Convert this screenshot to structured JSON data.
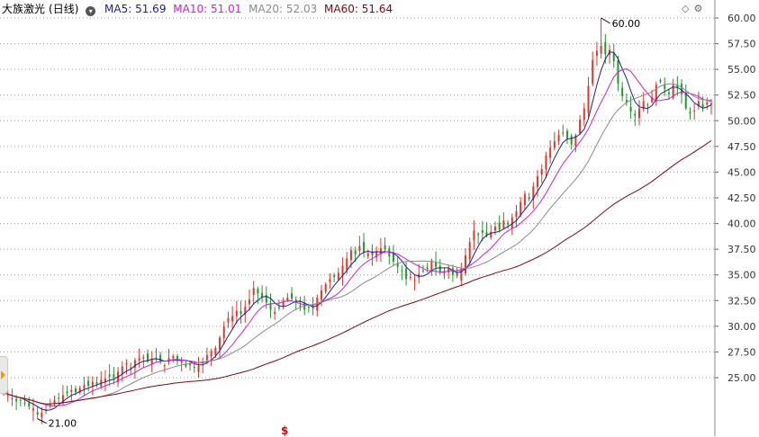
{
  "legend": {
    "symbol": "大族激光",
    "period": "(日线)",
    "items": [
      {
        "label": "MA5: 51.69",
        "color": "#1f1f8f"
      },
      {
        "label": "MA10: 51.01",
        "color": "#d020d0"
      },
      {
        "label": "MA20: 52.03",
        "color": "#8a8a8a"
      },
      {
        "label": "MA60: 51.64",
        "color": "#7a0a14"
      }
    ]
  },
  "corner_icons": [
    "diamond-icon",
    "gear-icon"
  ],
  "event_marker": "$",
  "chart_data": {
    "type": "candlestick",
    "ylim": [
      21.0,
      61.5
    ],
    "yticks": [
      "25.00",
      "27.50",
      "30.00",
      "32.50",
      "35.00",
      "37.50",
      "40.00",
      "42.50",
      "45.00",
      "47.50",
      "50.00",
      "52.50",
      "55.00",
      "57.50",
      "60.00"
    ],
    "grid": true,
    "annotations": [
      {
        "label": "60.00",
        "value": 60.0
      },
      {
        "label": "21.00",
        "value": 21.0
      }
    ],
    "series": [
      {
        "name": "MA5",
        "color": "#1f1f8f"
      },
      {
        "name": "MA10",
        "color": "#d020d0"
      },
      {
        "name": "MA20",
        "color": "#8a8a8a"
      },
      {
        "name": "MA60",
        "color": "#7a0a14"
      }
    ],
    "close": [
      23.5,
      23.3,
      23.0,
      22.7,
      22.8,
      22.5,
      22.2,
      22.0,
      21.4,
      21.6,
      21.9,
      22.4,
      22.8,
      23.0,
      23.3,
      23.5,
      23.8,
      23.6,
      24.0,
      24.3,
      24.2,
      24.6,
      24.4,
      24.8,
      24.9,
      25.1,
      25.0,
      25.6,
      26.1,
      26.4,
      26.0,
      26.7,
      26.9,
      27.0,
      26.6,
      26.8,
      26.9,
      26.5,
      26.2,
      26.9,
      27.1,
      26.7,
      26.6,
      26.1,
      26.4,
      26.0,
      26.2,
      26.5,
      27.2,
      27.6,
      27.9,
      28.9,
      30.0,
      30.8,
      31.0,
      31.5,
      31.2,
      31.9,
      32.6,
      33.7,
      33.2,
      32.8,
      32.3,
      31.6,
      31.4,
      31.8,
      32.5,
      32.8,
      32.7,
      32.3,
      31.9,
      31.6,
      31.8,
      31.9,
      32.8,
      33.5,
      34.1,
      34.6,
      34.8,
      35.2,
      35.9,
      36.6,
      37.4,
      37.0,
      37.8,
      37.2,
      37.1,
      36.9,
      37.3,
      37.6,
      37.5,
      36.8,
      36.3,
      35.8,
      35.4,
      34.6,
      34.8,
      34.5,
      35.1,
      35.4,
      35.6,
      36.4,
      35.8,
      35.2,
      35.4,
      35.6,
      35.0,
      34.9,
      35.6,
      36.9,
      38.2,
      39.3,
      38.9,
      39.1,
      38.8,
      39.2,
      39.7,
      39.4,
      40.3,
      39.9,
      40.6,
      41.2,
      42.1,
      42.9,
      42.4,
      43.6,
      44.6,
      45.3,
      46.6,
      47.4,
      48.0,
      48.6,
      48.8,
      48.3,
      47.7,
      48.6,
      50.1,
      51.2,
      53.4,
      55.9,
      56.8,
      57.3,
      56.5,
      56.9,
      55.8,
      53.6,
      52.4,
      51.8,
      50.9,
      50.5,
      51.2,
      51.9,
      51.5,
      52.3,
      53.5,
      53.8,
      53.1,
      52.6,
      53.5,
      53.2,
      52.6,
      51.2,
      50.7,
      51.0,
      51.9,
      51.3,
      51.8,
      51.7
    ],
    "date_range": "",
    "note": ""
  }
}
